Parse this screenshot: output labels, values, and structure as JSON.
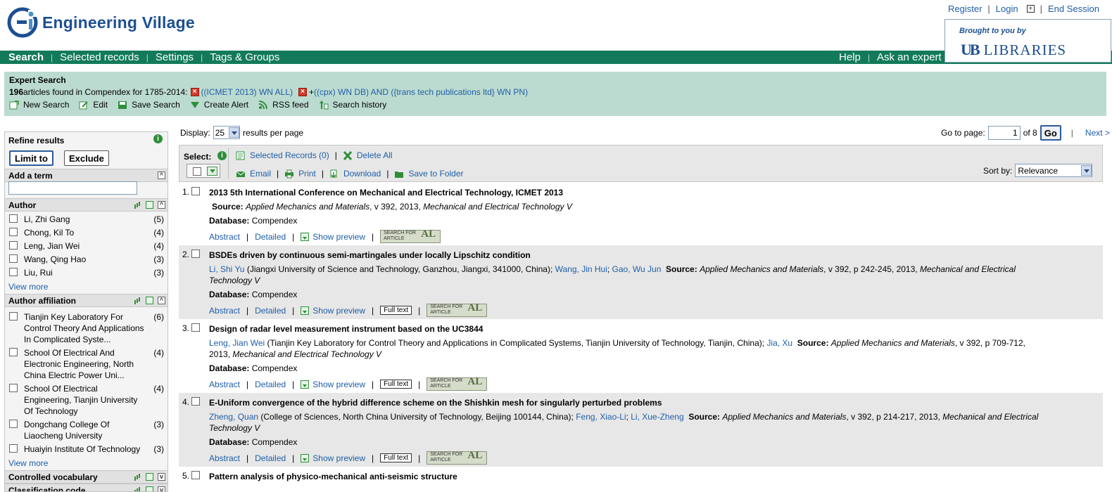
{
  "header": {
    "logo_text": "Engineering Village",
    "top_links": [
      "Register",
      "Login",
      "End Session"
    ],
    "brought_to_you": "Brought to you by",
    "ub_mark": "UB",
    "ub_libraries": "LIBRARIES"
  },
  "nav": {
    "left": [
      "Search",
      "Selected records",
      "Settings",
      "Tags & Groups"
    ],
    "right": [
      "Help",
      "Ask an expert"
    ]
  },
  "search_panel": {
    "title": "Expert Search",
    "count": "196",
    "summary_text": " articles found in Compendex for 1785-2014: ",
    "query1": "((ICMET 2013) WN ALL)",
    "plus": "+",
    "query2": "((cpx) WN DB) AND ({trans tech publications ltd} WN PN)",
    "actions": [
      "New Search",
      "Edit",
      "Save Search",
      "Create Alert",
      "RSS feed",
      "Search history"
    ]
  },
  "sidebar": {
    "refine_title": "Refine results",
    "limit_label": "Limit to",
    "exclude_label": "Exclude",
    "add_term_label": "Add a term",
    "author_head": "Author",
    "authors": [
      {
        "name": "Li, Zhi Gang",
        "count": "(5)"
      },
      {
        "name": "Chong, Kil To",
        "count": "(4)"
      },
      {
        "name": "Leng, Jian Wei",
        "count": "(4)"
      },
      {
        "name": "Wang, Qing Hao",
        "count": "(3)"
      },
      {
        "name": "Liu, Rui",
        "count": "(3)"
      }
    ],
    "view_more": "View more",
    "affiliation_head": "Author affiliation",
    "affiliations": [
      {
        "name": "Tianjin Key Laboratory For Control Theory And Applications In Complicated Syste...",
        "count": "(6)"
      },
      {
        "name": "School Of Electrical And Electronic Engineering, North China Electric Power Uni...",
        "count": "(4)"
      },
      {
        "name": "School Of Electrical Engineering, Tianjin University Of Technology",
        "count": "(4)"
      },
      {
        "name": "Dongchang College Of Liaocheng University",
        "count": "(3)"
      },
      {
        "name": "Huaiyin Institute Of Technology",
        "count": "(3)"
      }
    ],
    "controlled_vocab_head": "Controlled vocabulary",
    "classification_head": "Classification code"
  },
  "results_controls": {
    "display_label": "Display:",
    "display_value": "25",
    "per_page_label": "results per page",
    "goto_label": "Go to page:",
    "page_value": "1",
    "of_pages": "of 8",
    "go_label": "Go",
    "next_label": "Next >",
    "select_label": "Select:",
    "selected_records": "Selected Records (0)",
    "delete_all": "Delete All",
    "email": "Email",
    "print": "Print",
    "download": "Download",
    "save_to_folder": "Save to Folder",
    "sort_label": "Sort by:",
    "sort_value": "Relevance"
  },
  "link_labels": {
    "abstract": "Abstract",
    "detailed": "Detailed",
    "show_preview": "Show preview",
    "full_text": "Full text",
    "sfa_line1": "SEARCH FOR",
    "sfa_line2": "ARTICLE",
    "sfa_big": "AL",
    "source_label": "Source:",
    "database_label": "Database:",
    "database_value": "Compendex"
  },
  "results": [
    {
      "num": "1.",
      "title": "2013 5th International Conference on Mechanical and Electrical Technology, ICMET 2013",
      "source_journal": "Applied Mechanics and Materials",
      "source_rest": ", v 392, 2013, ",
      "source_conf": "Mechanical and Electrical Technology V"
    },
    {
      "num": "2.",
      "title": "BSDEs driven by continuous semi-martingales under locally Lipschitz condition",
      "author1": "Li, Shi Yu",
      "aff1": " (Jiangxi University of Science and Technology, Ganzhou, Jiangxi, 341000, China); ",
      "author2": "Wang, Jin Hui",
      "author3": "Gao, Wu Jun",
      "source_journal": "Applied Mechanics and Materials",
      "source_rest": ", v 392, p 242-245, 2013, ",
      "source_conf": "Mechanical and Electrical Technology V"
    },
    {
      "num": "3.",
      "title": "Design of radar level measurement instrument based on the UC3844",
      "author1": "Leng, Jian Wei",
      "aff1": " (Tianjin Key Laboratory for Control Theory and Applications in Complicated Systems, Tianjin University of Technology, Tianjin, China); ",
      "author2": "Jia, Xu",
      "source_journal": "Applied Mechanics and Materials",
      "source_rest": ", v 392, p 709-712, 2013, ",
      "source_conf": "Mechanical and Electrical Technology V"
    },
    {
      "num": "4.",
      "title": "E-Uniform convergence of the hybrid difference scheme on the Shishkin mesh for singularly perturbed problems",
      "author1": "Zheng, Quan",
      "aff1": " (College of Sciences, North China University of Technology, Beijing 100144, China); ",
      "author2": "Feng, Xiao-Li",
      "author3": "Li, Xue-Zheng",
      "source_journal": "Applied Mechanics and Materials",
      "source_rest": ", v 392, p 214-217, 2013, ",
      "source_conf": "Mechanical and Electrical Technology V"
    },
    {
      "num": "5.",
      "title": "Pattern analysis of physico-mechanical anti-seismic structure"
    }
  ]
}
